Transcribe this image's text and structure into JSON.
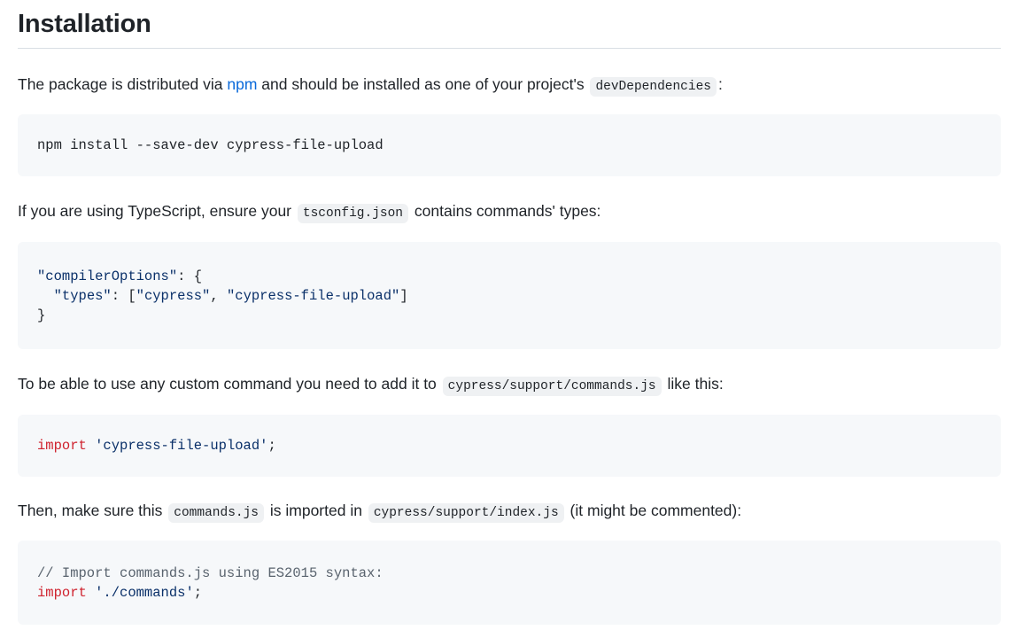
{
  "heading": "Installation",
  "p1": {
    "before": "The package is distributed via ",
    "link": "npm",
    "middle": " and should be installed as one of your project's",
    "code": "devDependencies",
    "after": ":"
  },
  "code1": {
    "line1": "npm install --save-dev cypress-file-upload"
  },
  "p2": {
    "before": "If you are using TypeScript, ensure your",
    "code": "tsconfig.json",
    "after": "contains commands' types:"
  },
  "code2": {
    "l1_key": "\"compilerOptions\"",
    "l1_rest": ": {",
    "l2_indent": "  ",
    "l2_key": "\"types\"",
    "l2_sep": ": [",
    "l2_v1": "\"cypress\"",
    "l2_comma": ", ",
    "l2_v2": "\"cypress-file-upload\"",
    "l2_end": "]",
    "l3": "}"
  },
  "p3": {
    "before": "To be able to use any custom command you need to add it to",
    "code": "cypress/support/commands.js",
    "after": "like this:"
  },
  "code3": {
    "kw": "import",
    "sp": " ",
    "str": "'cypress-file-upload'",
    "end": ";"
  },
  "p4": {
    "before": "Then, make sure this",
    "code1": "commands.js",
    "middle": "is imported in",
    "code2": "cypress/support/index.js",
    "after": "(it might be commented):"
  },
  "code4": {
    "comment": "// Import commands.js using ES2015 syntax:",
    "kw": "import",
    "sp": " ",
    "str": "'./commands'",
    "end": ";"
  },
  "colors": {
    "link": "#0969da",
    "keyword": "#cf222e",
    "string": "#0a3069",
    "comment": "#59636e",
    "code_bg": "#f6f8fa"
  }
}
